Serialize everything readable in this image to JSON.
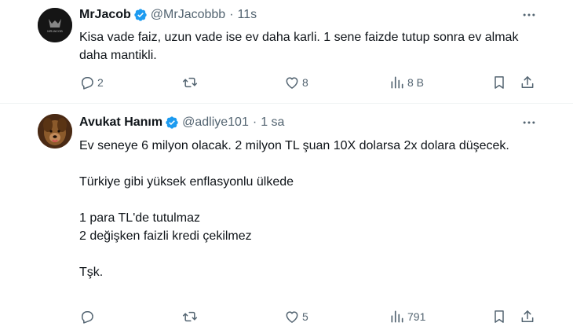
{
  "tweets": [
    {
      "name": "MrJacob",
      "handle": "@MrJacobbb",
      "separator": "·",
      "time": "11s",
      "avatar_label": "MRJACOB",
      "text_paragraphs": [
        "Kisa vade faiz, uzun vade ise ev daha karli. 1 sene faizde tutup sonra ev almak daha mantikli."
      ],
      "stats": {
        "replies": "2",
        "retweets": "",
        "likes": "8",
        "views": "8 B"
      }
    },
    {
      "name": "Avukat Hanım",
      "handle": "@adliye101",
      "separator": "·",
      "time": "1 sa",
      "text_paragraphs": [
        "Ev seneye 6 milyon olacak. 2 milyon TL şuan 10X dolarsa 2x dolara düşecek.",
        "",
        "Türkiye gibi yüksek enflasyonlu ülkede",
        "",
        "1 para TL'de tutulmaz",
        "2 değişken faizli kredi çekilmez",
        "",
        "Tşk."
      ],
      "stats": {
        "replies": "",
        "retweets": "",
        "likes": "5",
        "views": "791"
      }
    }
  ],
  "icons": {
    "verified": "verified-badge-icon",
    "more": "more-dots-icon",
    "reply": "reply-icon",
    "retweet": "retweet-icon",
    "like": "heart-icon",
    "views": "views-bar-icon",
    "bookmark": "bookmark-icon",
    "share": "share-icon"
  },
  "colors": {
    "verified": "#1d9bf0",
    "muted": "#536471",
    "text": "#0f1419",
    "divider": "#eff3f4"
  }
}
